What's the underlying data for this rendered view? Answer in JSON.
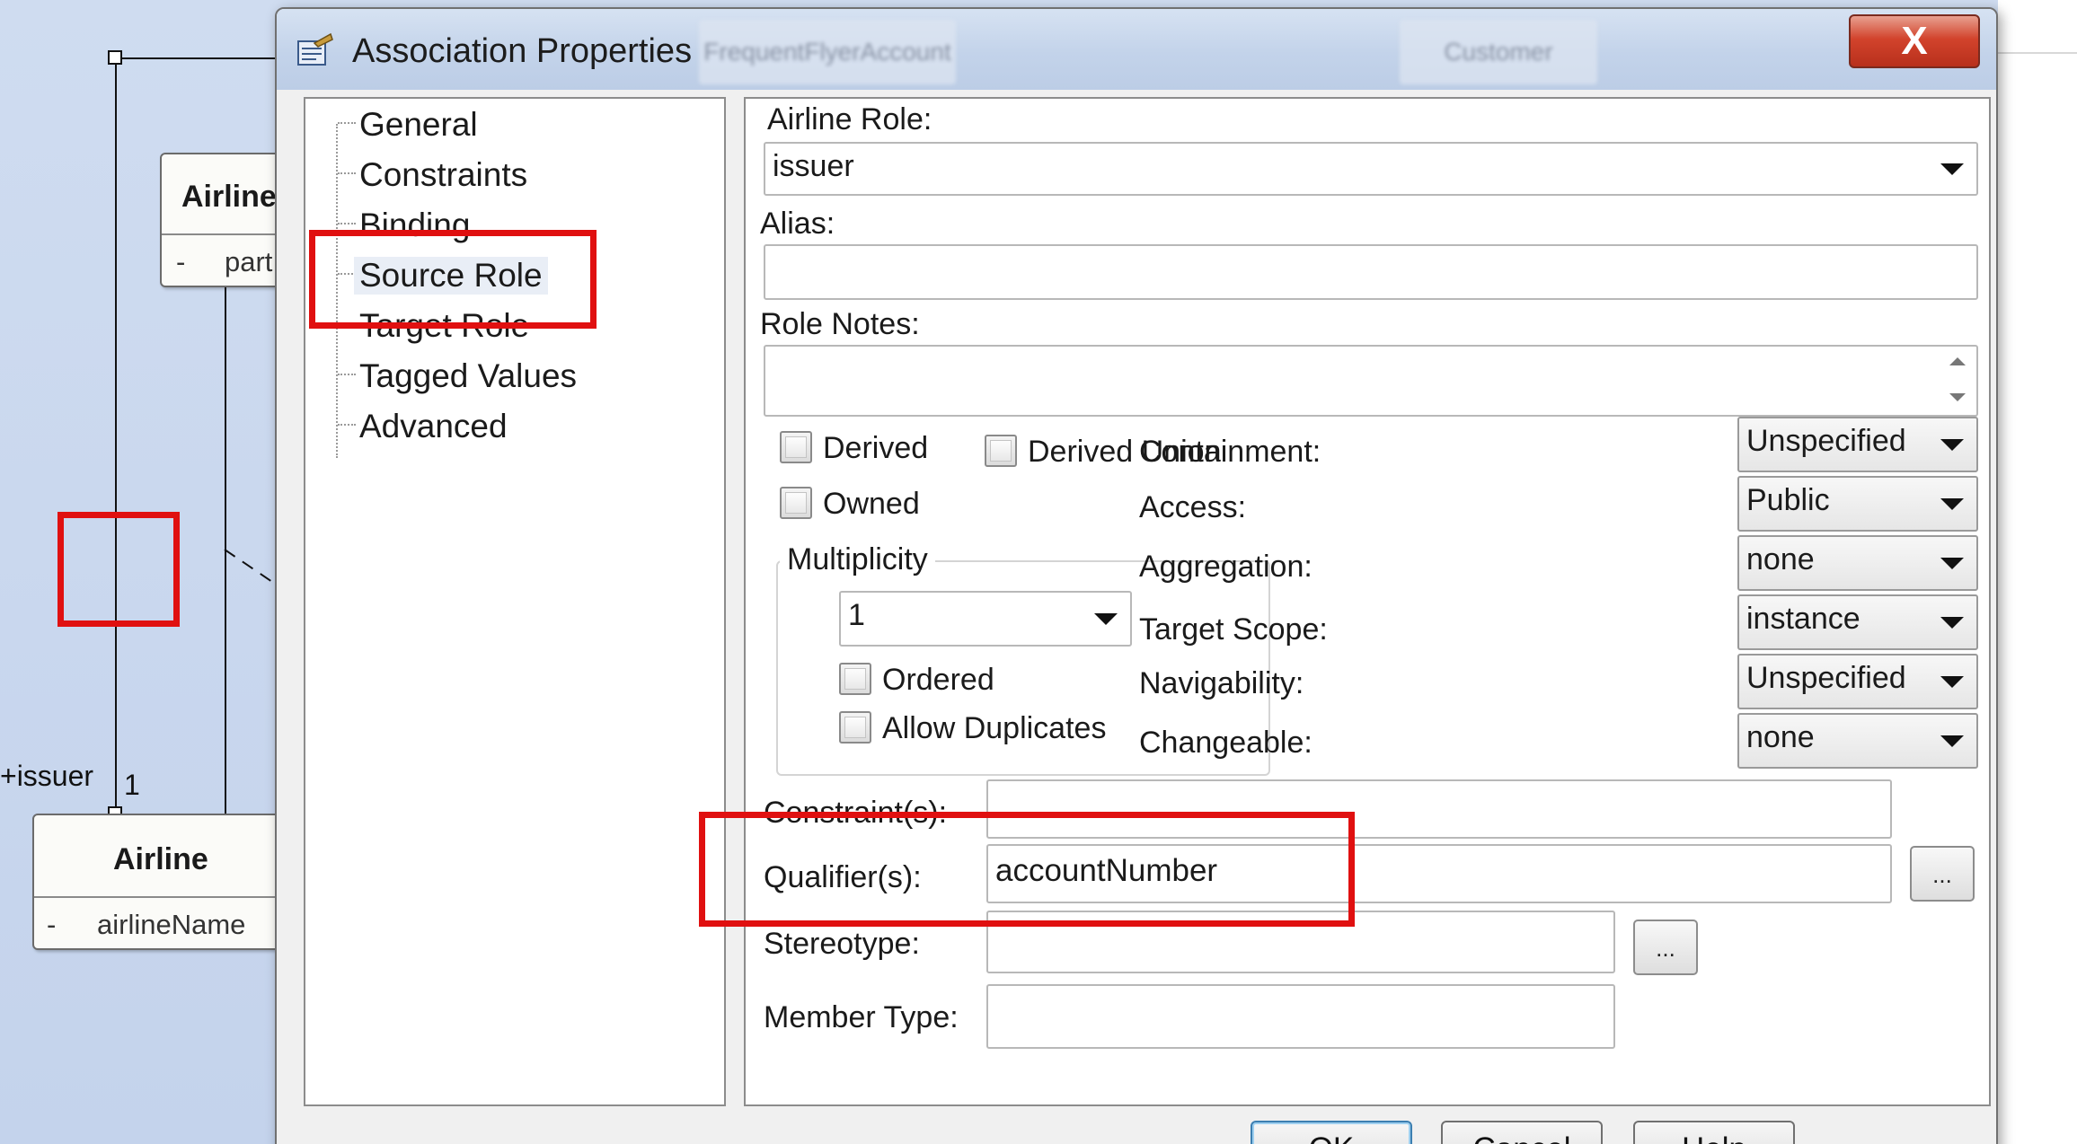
{
  "diagram": {
    "upper_class": {
      "name": "Airline",
      "attr_visibility": "-",
      "attr_text": "part"
    },
    "lower_class": {
      "name": "Airline",
      "attr_visibility": "-",
      "attr_text": "airlineName"
    },
    "role_label": "+issuer",
    "multiplicity_label": "1"
  },
  "dialog": {
    "title": "Association Properties",
    "background_tabs": [
      "FrequentFlyerAccount",
      "Customer"
    ],
    "close_label": "X",
    "tree": {
      "items": [
        {
          "label": "General"
        },
        {
          "label": "Constraints"
        },
        {
          "label": "Binding"
        },
        {
          "label": "Source Role"
        },
        {
          "label": "Target Role"
        },
        {
          "label": "Tagged Values"
        },
        {
          "label": "Advanced"
        }
      ],
      "selected": "Source Role"
    },
    "role": {
      "label": "Airline Role:",
      "value": "issuer"
    },
    "alias": {
      "label": "Alias:",
      "value": ""
    },
    "role_notes": {
      "label": "Role Notes:",
      "value": ""
    },
    "checkboxes": {
      "derived": {
        "label": "Derived",
        "checked": false
      },
      "derived_union": {
        "label": "Derived Union",
        "checked": false
      },
      "owned": {
        "label": "Owned",
        "checked": false
      },
      "ordered": {
        "label": "Ordered",
        "checked": false
      },
      "allow_duplicates": {
        "label": "Allow Duplicates",
        "checked": false
      }
    },
    "multiplicity": {
      "group_label": "Multiplicity",
      "value": "1"
    },
    "properties": [
      {
        "label": "Containment:",
        "value": "Unspecified"
      },
      {
        "label": "Access:",
        "value": "Public"
      },
      {
        "label": "Aggregation:",
        "value": "none"
      },
      {
        "label": "Target Scope:",
        "value": "instance"
      },
      {
        "label": "Navigability:",
        "value": "Unspecified"
      },
      {
        "label": "Changeable:",
        "value": "none"
      }
    ],
    "constraints": {
      "label": "Constraint(s):",
      "value": ""
    },
    "qualifiers": {
      "label": "Qualifier(s):",
      "value": "accountNumber",
      "button_label": "..."
    },
    "stereotype": {
      "label": "Stereotype:",
      "value": "",
      "button_label": "..."
    },
    "member_type": {
      "label": "Member Type:",
      "value": ""
    },
    "buttons": {
      "ok": "OK",
      "cancel": "Cancel",
      "help": "Help"
    }
  },
  "colors": {
    "annotation_red": "#e01010",
    "diagram_background": "#c9d8ee",
    "dialog_face": "#f0f0f0",
    "close_button": "#d2432c"
  },
  "icons": [
    "association-properties-icon",
    "close-icon",
    "dropdown-arrow-icon",
    "scroll-up-icon",
    "scroll-down-icon"
  ]
}
